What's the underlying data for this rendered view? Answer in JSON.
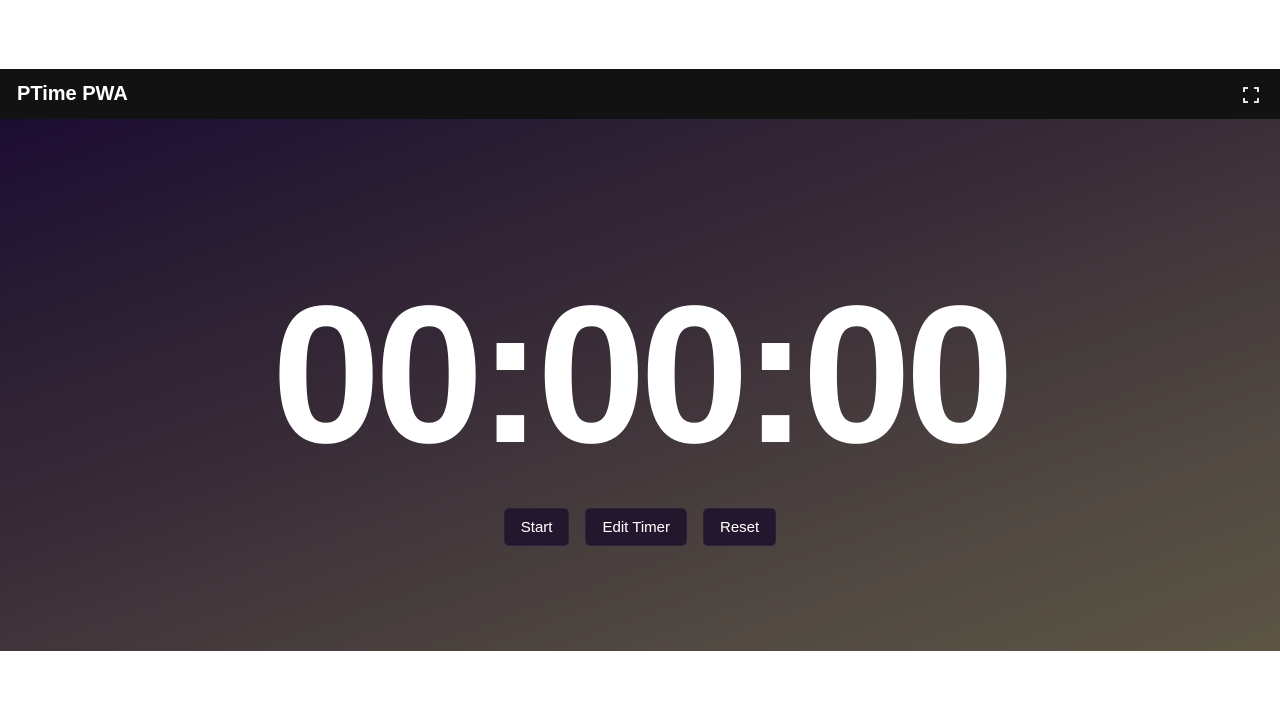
{
  "header": {
    "title": "PTime PWA",
    "fullscreen_icon": "fullscreen-icon"
  },
  "timer": {
    "display": "00:00:00"
  },
  "controls": {
    "start_label": "Start",
    "edit_label": "Edit Timer",
    "reset_label": "Reset"
  },
  "colors": {
    "header_bg": "#121212",
    "gradient_start": "#1c0c33",
    "gradient_end": "#5c5545",
    "button_bg": "#23172e"
  }
}
